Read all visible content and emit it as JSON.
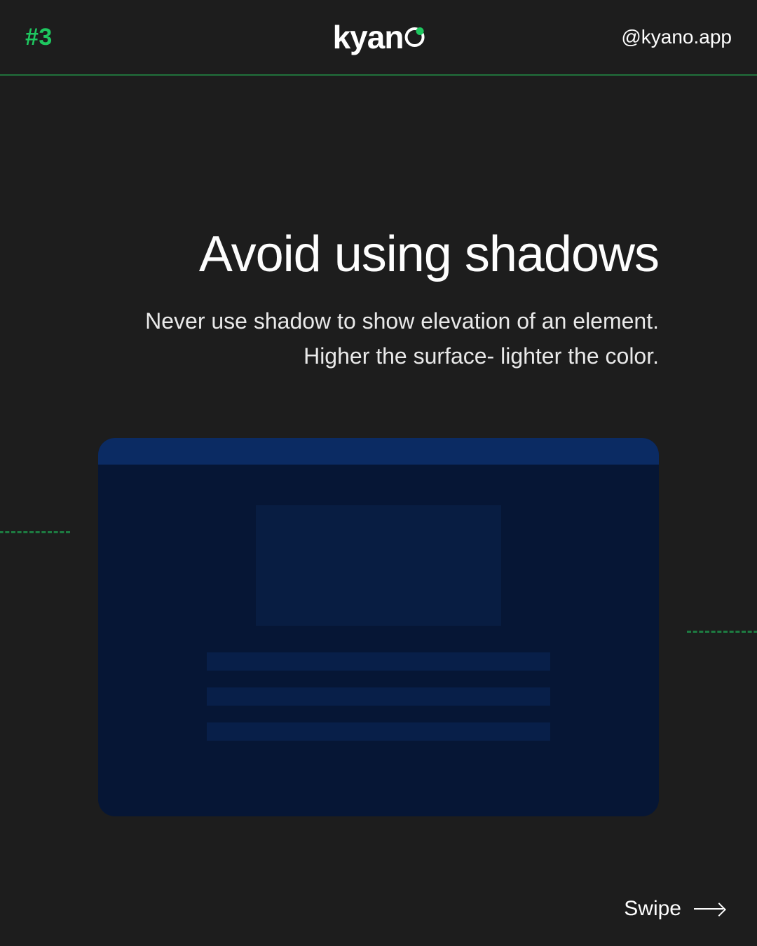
{
  "header": {
    "slide_number": "#3",
    "logo_text": "kyan",
    "handle": "@kyano.app"
  },
  "main": {
    "title": "Avoid using shadows",
    "subtitle_line1": "Never use shadow to show elevation of an element.",
    "subtitle_line2": "Higher the surface- lighter the color."
  },
  "footer": {
    "swipe_label": "Swipe"
  },
  "colors": {
    "bg": "#1d1d1d",
    "accent": "#1ec75f",
    "card_bg": "#061635",
    "card_top": "#0b2b63",
    "card_block": "#081d42",
    "card_line": "#081f49"
  }
}
